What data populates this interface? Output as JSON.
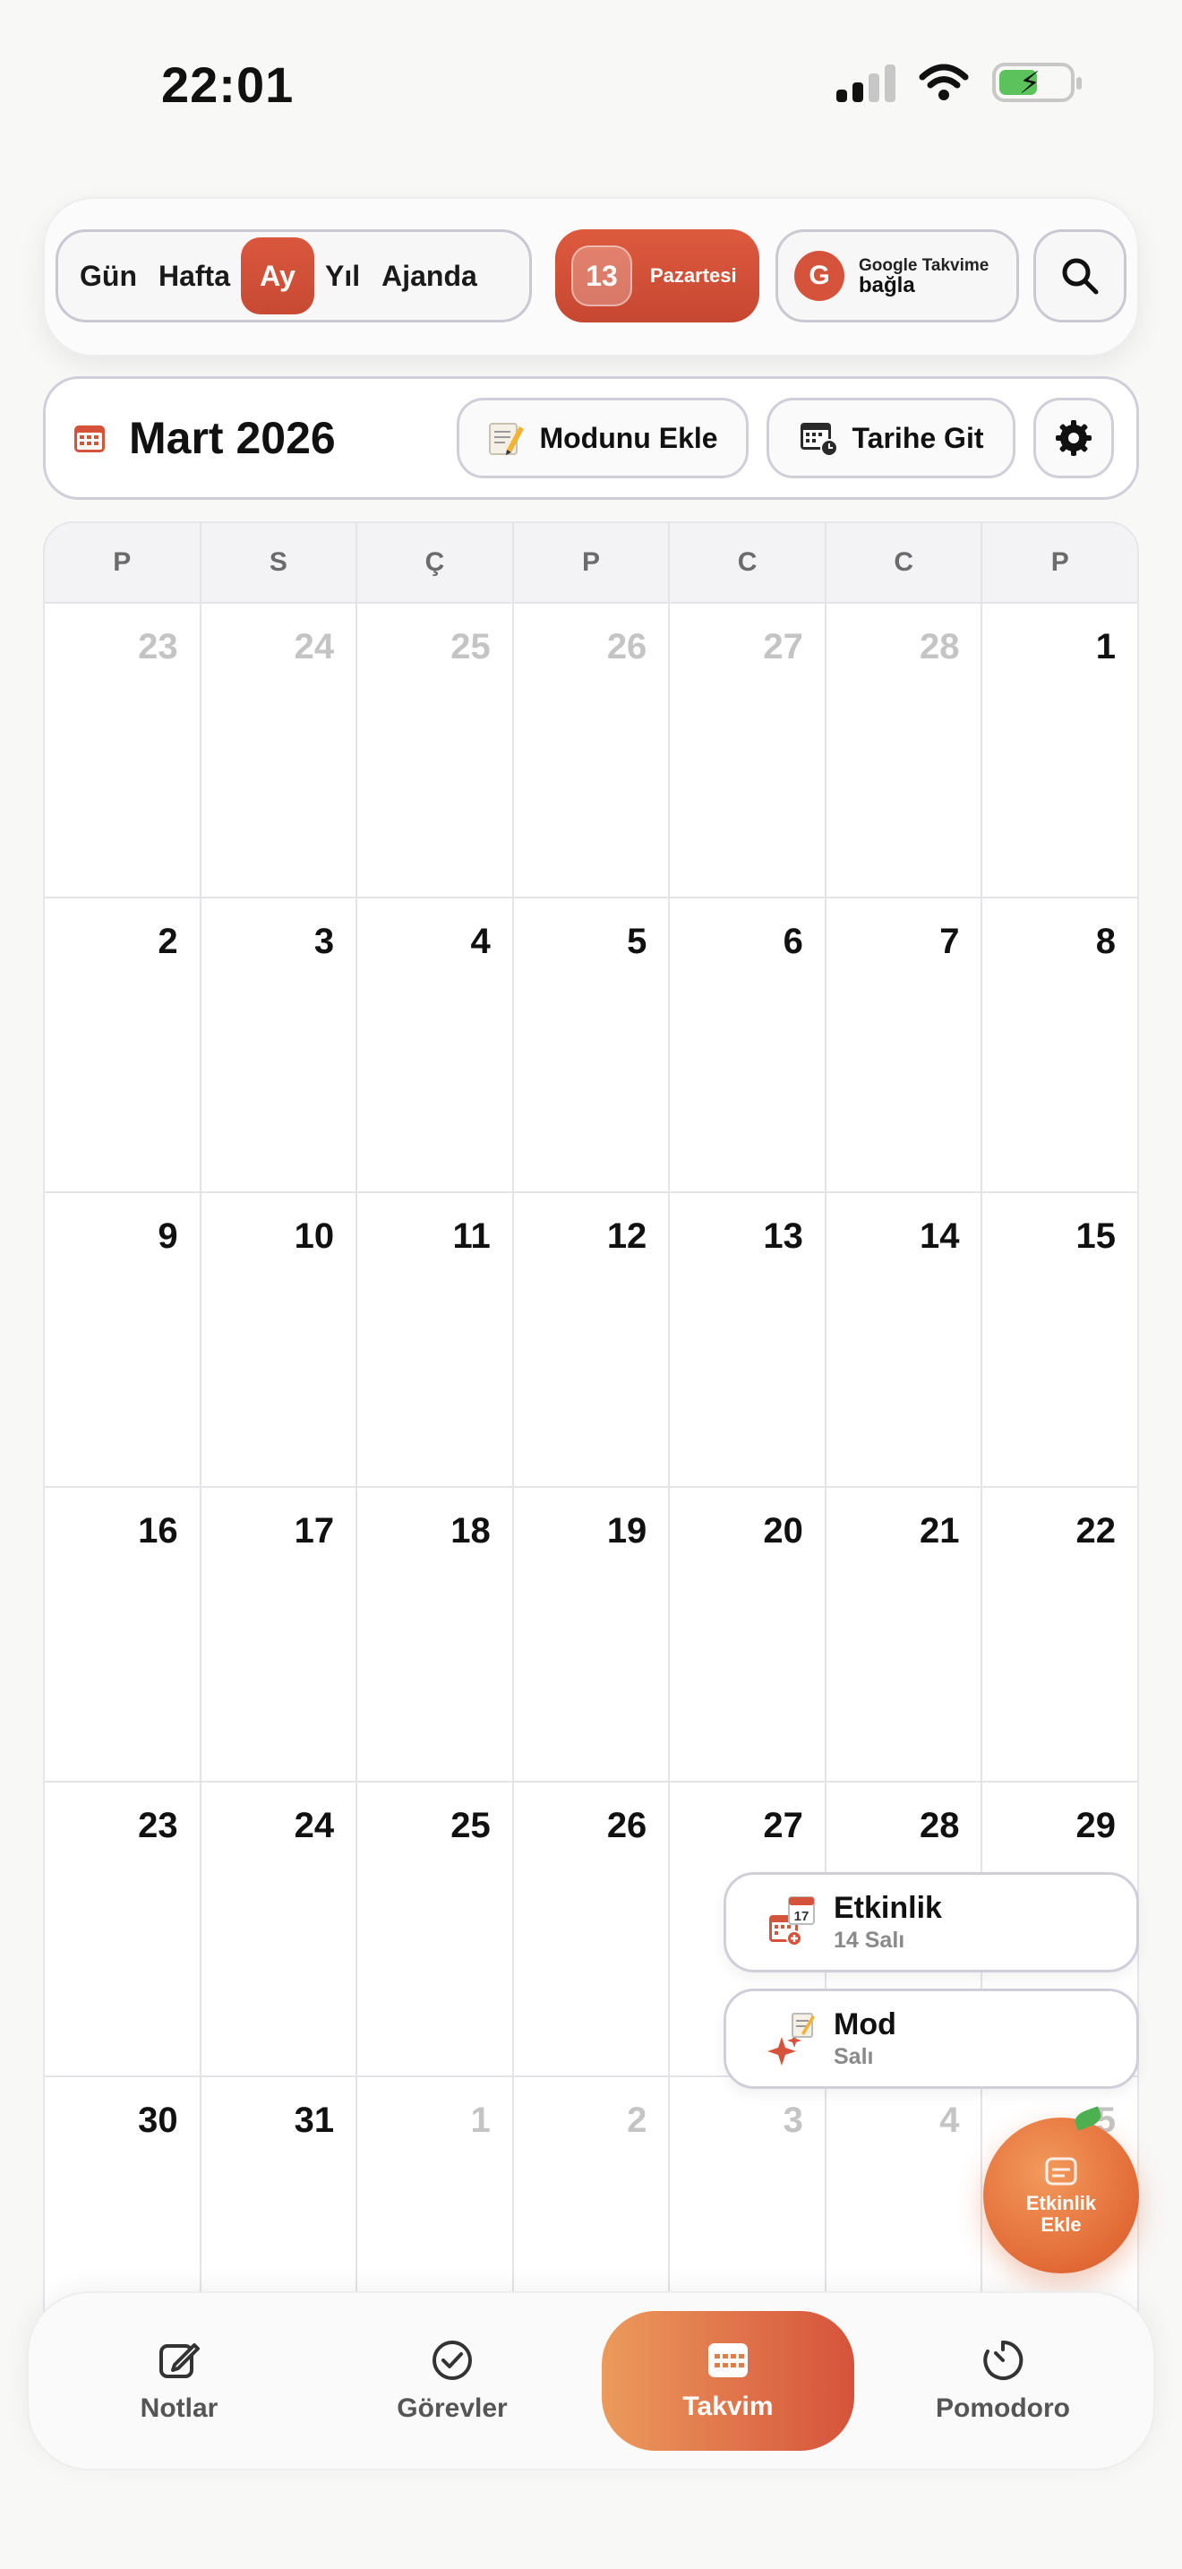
{
  "status_bar": {
    "time": "22:01"
  },
  "toolbar": {
    "view_modes": [
      "Gün",
      "Hafta",
      "Ay",
      "Yıl",
      "Ajanda"
    ],
    "active_view": "Ay",
    "today": {
      "day_number": "13",
      "day_name": "Pazartesi"
    },
    "google": {
      "letter": "G",
      "line1": "Google Takvime",
      "line2": "bağla"
    }
  },
  "header": {
    "month_title": "Mart 2026",
    "mood_button": "Modunu Ekle",
    "goto_button": "Tarihe Git"
  },
  "calendar": {
    "weekdays": [
      "P",
      "S",
      "Ç",
      "P",
      "C",
      "C",
      "P"
    ],
    "weeks": [
      [
        {
          "d": "23",
          "other": true
        },
        {
          "d": "24",
          "other": true
        },
        {
          "d": "25",
          "other": true
        },
        {
          "d": "26",
          "other": true
        },
        {
          "d": "27",
          "other": true
        },
        {
          "d": "28",
          "other": true
        },
        {
          "d": "1",
          "other": false
        }
      ],
      [
        {
          "d": "2",
          "other": false
        },
        {
          "d": "3",
          "other": false
        },
        {
          "d": "4",
          "other": false
        },
        {
          "d": "5",
          "other": false
        },
        {
          "d": "6",
          "other": false
        },
        {
          "d": "7",
          "other": false
        },
        {
          "d": "8",
          "other": false
        }
      ],
      [
        {
          "d": "9",
          "other": false
        },
        {
          "d": "10",
          "other": false
        },
        {
          "d": "11",
          "other": false
        },
        {
          "d": "12",
          "other": false
        },
        {
          "d": "13",
          "other": false
        },
        {
          "d": "14",
          "other": false
        },
        {
          "d": "15",
          "other": false
        }
      ],
      [
        {
          "d": "16",
          "other": false
        },
        {
          "d": "17",
          "other": false
        },
        {
          "d": "18",
          "other": false
        },
        {
          "d": "19",
          "other": false
        },
        {
          "d": "20",
          "other": false
        },
        {
          "d": "21",
          "other": false
        },
        {
          "d": "22",
          "other": false
        }
      ],
      [
        {
          "d": "23",
          "other": false
        },
        {
          "d": "24",
          "other": false
        },
        {
          "d": "25",
          "other": false
        },
        {
          "d": "26",
          "other": false
        },
        {
          "d": "27",
          "other": false
        },
        {
          "d": "28",
          "other": false
        },
        {
          "d": "29",
          "other": false
        }
      ],
      [
        {
          "d": "30",
          "other": false
        },
        {
          "d": "31",
          "other": false
        },
        {
          "d": "1",
          "other": true
        },
        {
          "d": "2",
          "other": true
        },
        {
          "d": "3",
          "other": true
        },
        {
          "d": "4",
          "other": true
        },
        {
          "d": "5",
          "other": true
        }
      ]
    ]
  },
  "fab_menu": {
    "event": {
      "title": "Etkinlik",
      "subtitle": "14 Salı",
      "badge": "17"
    },
    "mood": {
      "title": "Mod",
      "subtitle": "Salı"
    },
    "fab_label_1": "Etkinlik",
    "fab_label_2": "Ekle"
  },
  "tabbar": {
    "tabs": [
      {
        "label": "Notlar",
        "icon": "compose-icon"
      },
      {
        "label": "Görevler",
        "icon": "check-circle-icon"
      },
      {
        "label": "Takvim",
        "icon": "calendar-icon"
      },
      {
        "label": "Pomodoro",
        "icon": "timer-icon"
      }
    ],
    "active": "Takvim"
  },
  "colors": {
    "accent": "#d5533b",
    "accent_orange": "#ec9a5c",
    "muted_day": "#c4c4c4"
  }
}
